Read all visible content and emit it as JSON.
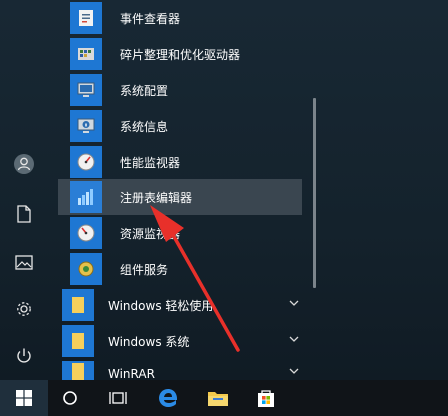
{
  "start_menu": {
    "apps": [
      {
        "label": "事件查看器",
        "icon": "event-viewer-icon"
      },
      {
        "label": "碎片整理和优化驱动器",
        "icon": "defrag-icon"
      },
      {
        "label": "系统配置",
        "icon": "system-config-icon"
      },
      {
        "label": "系统信息",
        "icon": "system-info-icon"
      },
      {
        "label": "性能监视器",
        "icon": "performance-monitor-icon"
      },
      {
        "label": "注册表编辑器",
        "icon": "registry-editor-icon"
      },
      {
        "label": "资源监视器",
        "icon": "resource-monitor-icon"
      },
      {
        "label": "组件服务",
        "icon": "component-services-icon"
      }
    ],
    "folders": [
      {
        "label": "Windows 轻松使用"
      },
      {
        "label": "Windows 系统"
      },
      {
        "label": "WinRAR"
      }
    ],
    "highlighted_item": "注册表编辑器",
    "rail": [
      "user-avatar-icon",
      "document-icon",
      "pictures-icon",
      "settings-icon",
      "power-icon"
    ]
  },
  "taskbar": {
    "items": [
      "windows-start-icon",
      "cortana-search-icon",
      "task-view-icon",
      "edge-icon",
      "file-explorer-icon",
      "store-icon"
    ]
  },
  "colors": {
    "accent": "#1e77d3",
    "highlight": "#3a4650",
    "annotation_arrow": "#e8302a",
    "folder": "#f5cf5b"
  }
}
